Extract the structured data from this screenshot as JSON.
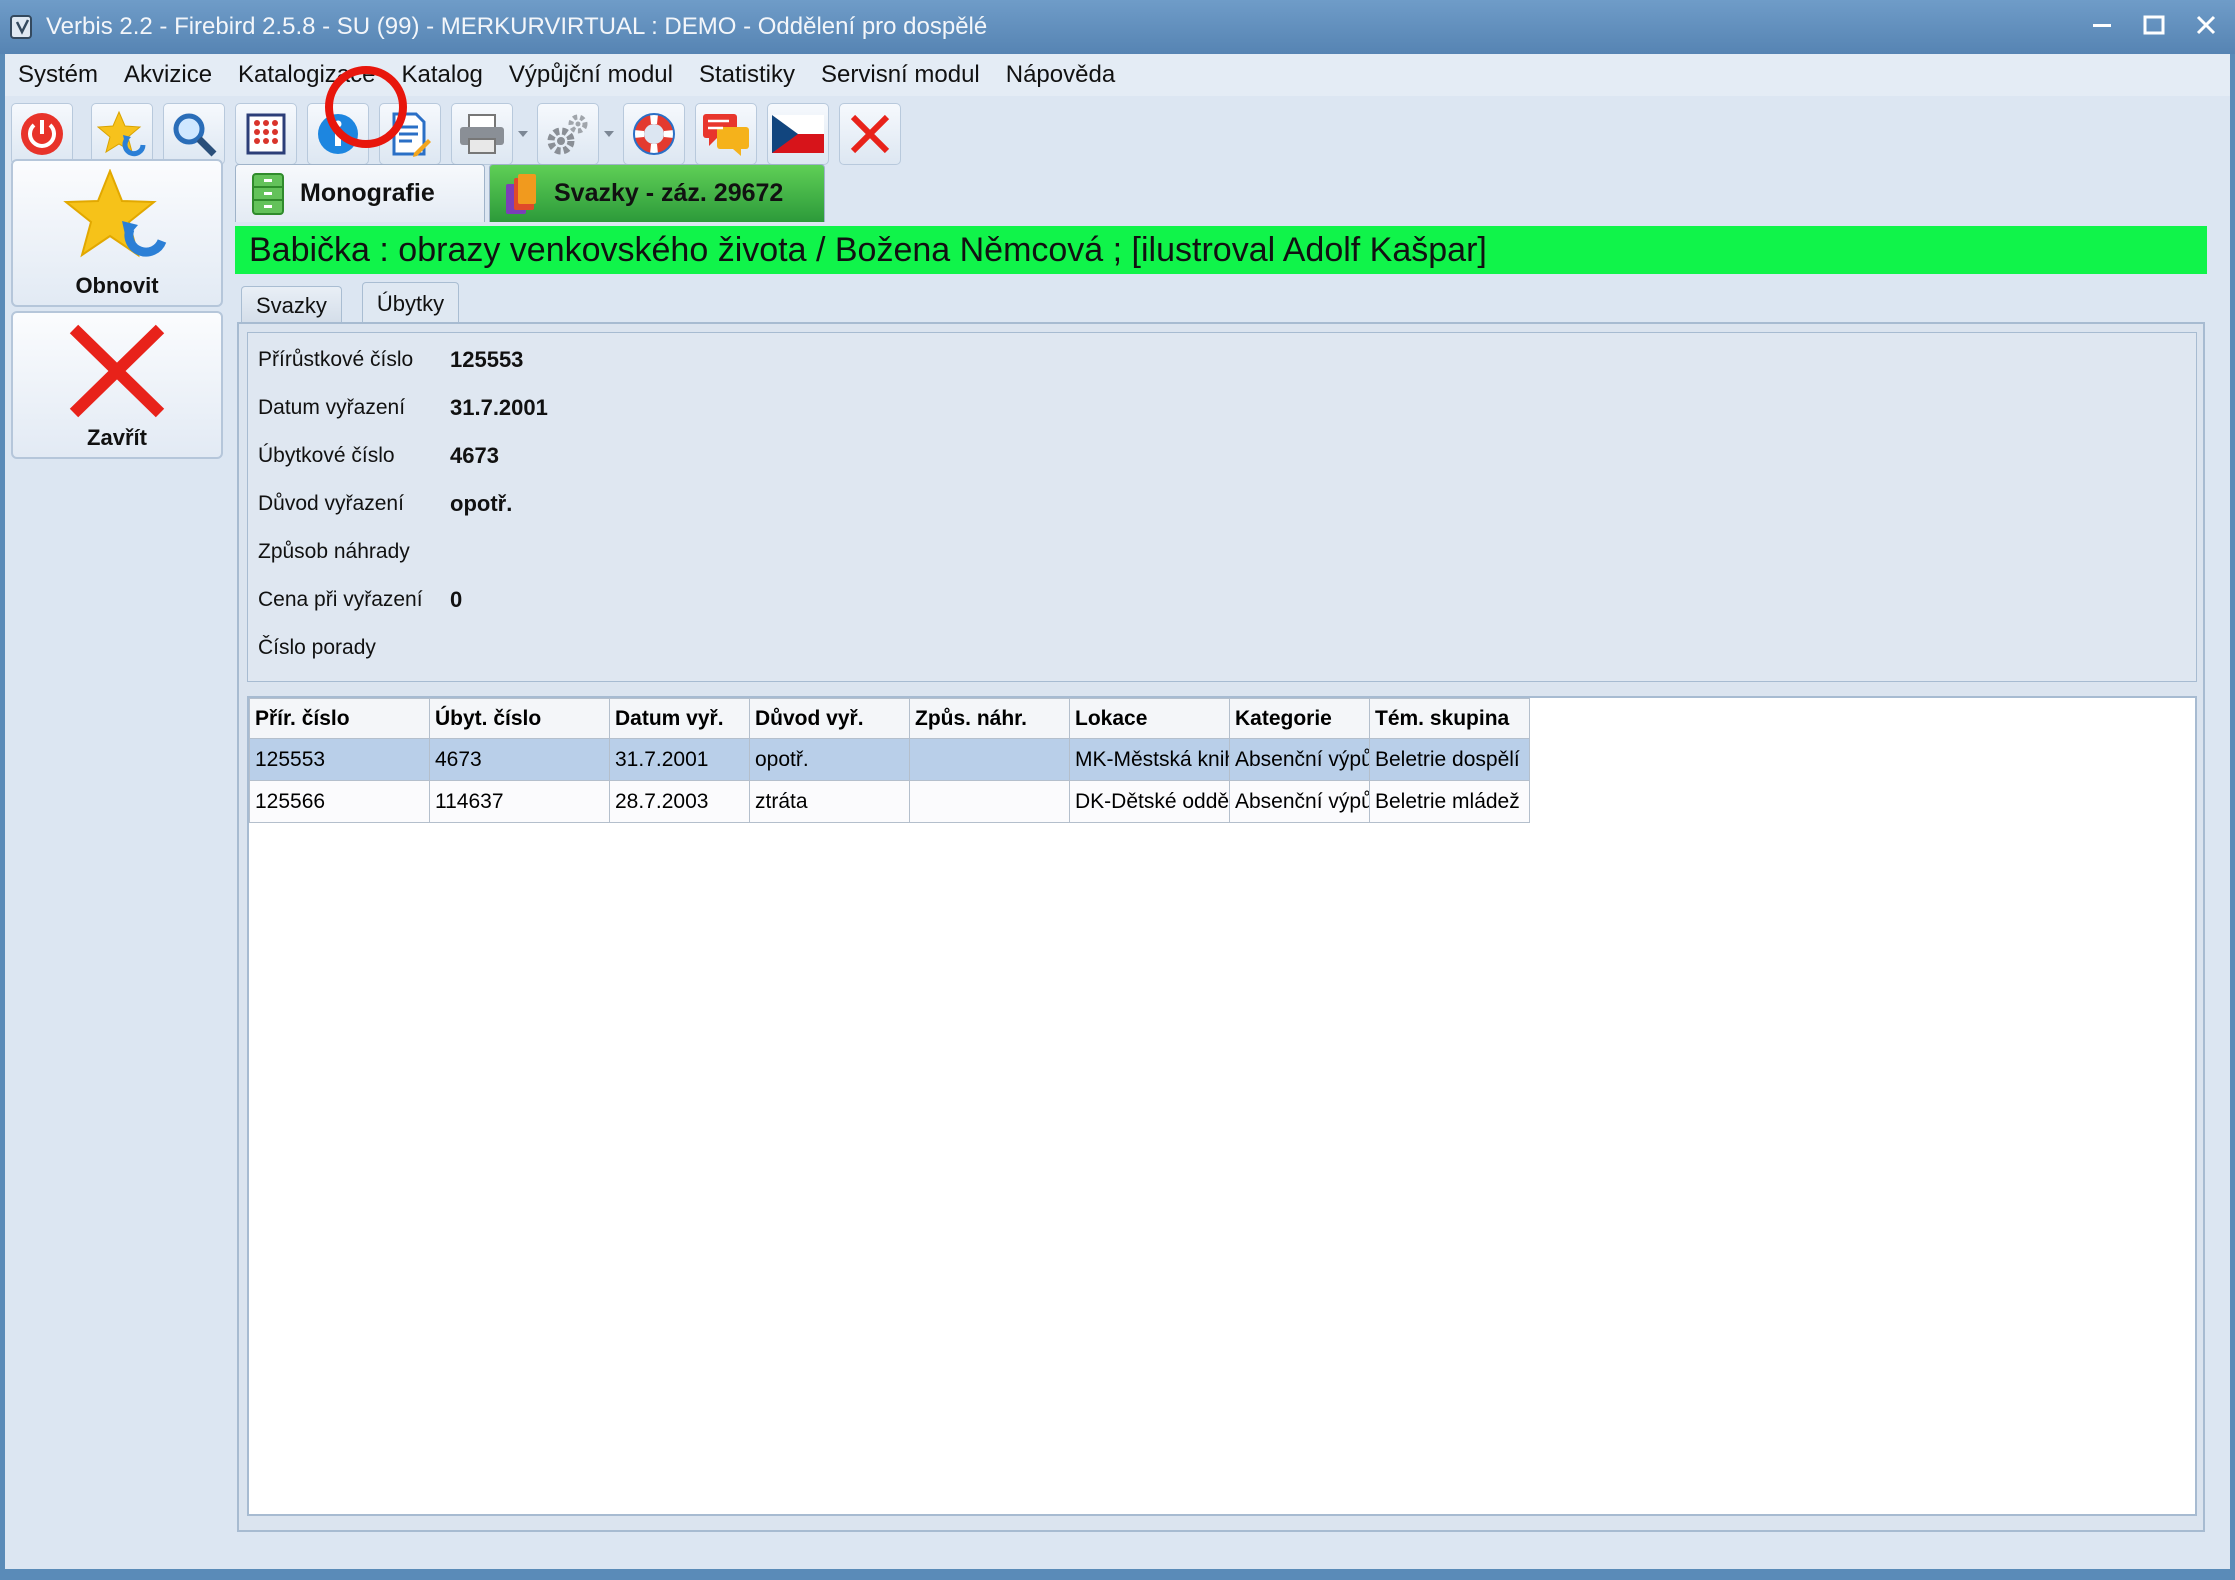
{
  "window": {
    "title": "Verbis 2.2 - Firebird 2.5.8 - SU (99) - MERKURVIRTUAL : DEMO - Oddělení pro dospělé"
  },
  "menu": [
    "Systém",
    "Akvizice",
    "Katalogizace",
    "Katalog",
    "Výpůjční modul",
    "Statistiky",
    "Servisní modul",
    "Nápověda"
  ],
  "toolbar": {
    "buttons": [
      "power-icon",
      "refresh-star-icon",
      "search-icon",
      "abacus-icon",
      "info-icon",
      "edit-document-icon",
      "printer-icon",
      "gear-icon",
      "lifebuoy-icon",
      "chat-icon",
      "czech-flag-icon",
      "close-icon"
    ]
  },
  "left": {
    "refresh_label": "Obnovit",
    "close_label": "Zavřít"
  },
  "tabs": {
    "monografie": "Monografie",
    "svazky": "Svazky - záz. 29672"
  },
  "record_title": "Babička : obrazy venkovského života / Božena Němcová ; [ilustroval Adolf Kašpar]",
  "subtabs": {
    "svazky": "Svazky",
    "ubytky": "Úbytky"
  },
  "detail": {
    "fields": [
      {
        "label": "Přírůstkové číslo",
        "value": "125553"
      },
      {
        "label": "Datum vyřazení",
        "value": "31.7.2001"
      },
      {
        "label": "Úbytkové číslo",
        "value": "4673"
      },
      {
        "label": "Důvod vyřazení",
        "value": "opotř."
      },
      {
        "label": "Způsob náhrady",
        "value": ""
      },
      {
        "label": "Cena při vyřazení",
        "value": "0"
      },
      {
        "label": "Číslo porady",
        "value": ""
      }
    ]
  },
  "grid": {
    "columns": [
      "Přír. číslo",
      "Úbyt. číslo",
      "Datum vyř.",
      "Důvod vyř.",
      "Způs. náhr.",
      "Lokace",
      "Kategorie",
      "Tém. skupina"
    ],
    "rows": [
      [
        "125553",
        "4673",
        "31.7.2001",
        "opotř.",
        "",
        "MK-Městská knihovna",
        "Absenční výpůjčka",
        "Beletrie dospělí"
      ],
      [
        "125566",
        "114637",
        "28.7.2003",
        "ztráta",
        "",
        "DK-Dětské oddělení",
        "Absenční výpůjčka",
        "Beletrie mládež"
      ]
    ]
  },
  "colors": {
    "title_bar": "#5f8dbb",
    "record_title_bg": "#10f44a",
    "active_tab": "#3fb548",
    "selected_row": "#b9cfe9",
    "highlight_ring": "#e8160c"
  }
}
